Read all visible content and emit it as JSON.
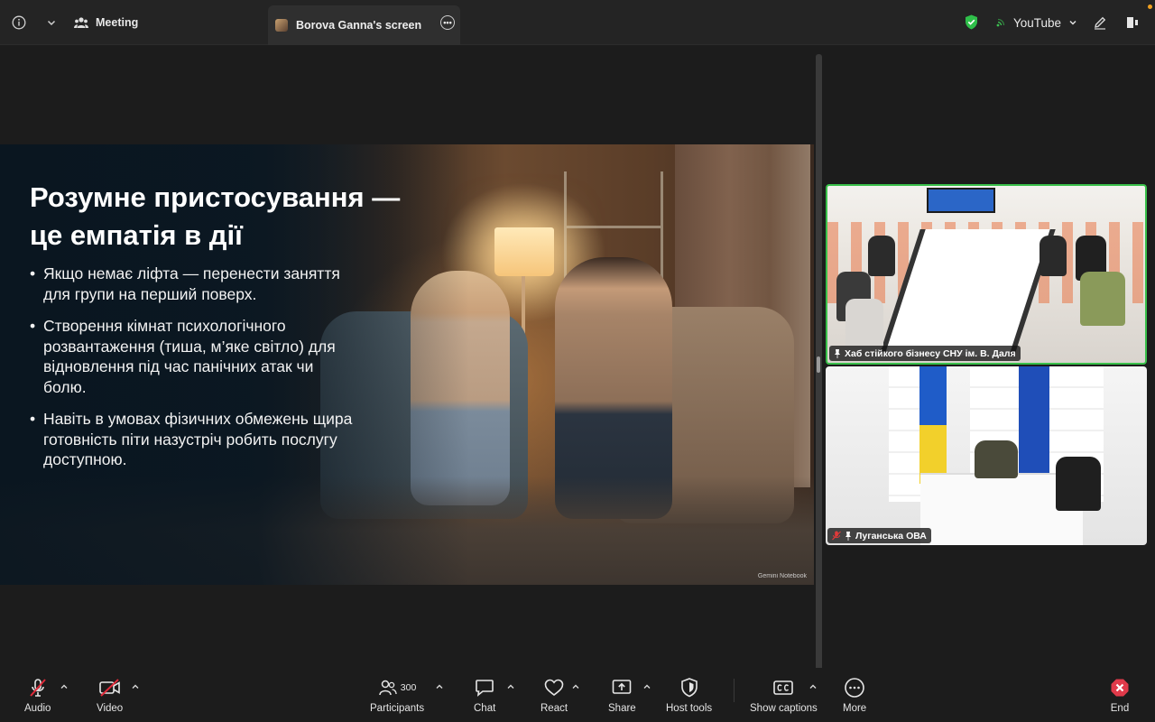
{
  "topbar": {
    "info_icon": "info-icon",
    "meeting_tab_label": "Meeting",
    "screen_tab_label": "Borova Ganna's screen",
    "youtube_label": "YouTube",
    "accent_green": "#39c04a"
  },
  "slide": {
    "title_line1": "Розумне пристосування —",
    "title_line2": "це емпатія в дії",
    "bullets": [
      "Якщо немає ліфта — перенести заняття для групи на перший поверх.",
      "Створення кімнат психологічного розвантаження (тиша, м’яке світло) для відновлення під час панічних атак чи болю.",
      "Навіть в умовах фізичних обмежень щира готовність піти назустріч робить послугу доступною."
    ],
    "watermark": "Gemini Notebook"
  },
  "tiles": [
    {
      "label": "Хаб стійкого бізнесу СНУ ім. В. Даля",
      "active": true
    },
    {
      "label": "Луганська ОВА",
      "muted": true
    }
  ],
  "toolbar": {
    "audio_label": "Audio",
    "video_label": "Video",
    "participants_label": "Participants",
    "participants_count": "300",
    "chat_label": "Chat",
    "react_label": "React",
    "share_label": "Share",
    "host_tools_label": "Host tools",
    "captions_label": "Show captions",
    "more_label": "More",
    "end_label": "End",
    "end_color": "#e03a4a"
  }
}
